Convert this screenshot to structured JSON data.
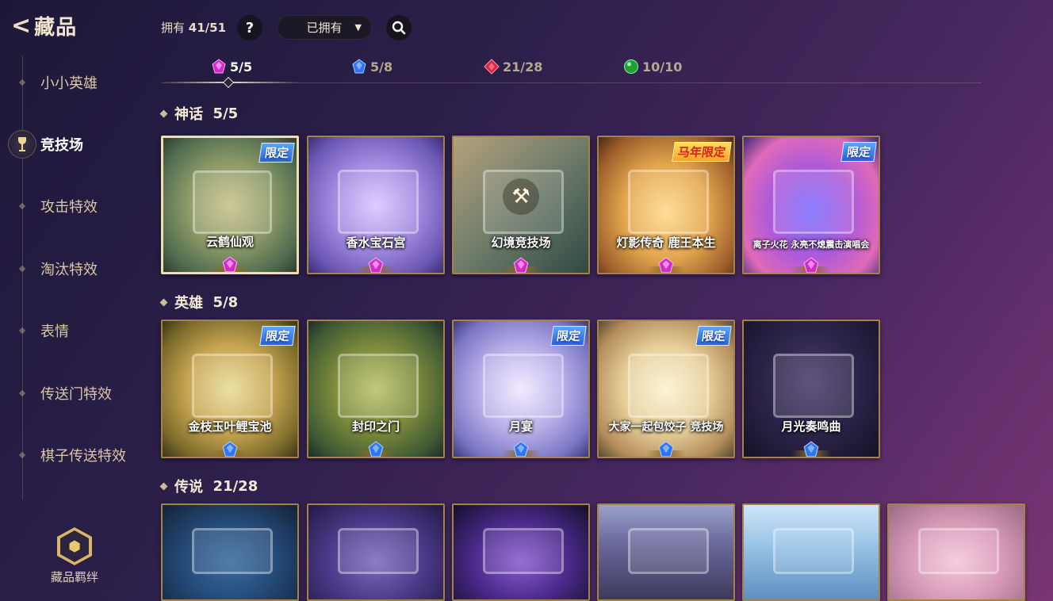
{
  "header": {
    "back_label": "藏品"
  },
  "sidebar": {
    "items": [
      {
        "label": "小小英雄",
        "active": false
      },
      {
        "label": "竞技场",
        "active": true
      },
      {
        "label": "攻击特效",
        "active": false
      },
      {
        "label": "淘汰特效",
        "active": false
      },
      {
        "label": "表情",
        "active": false
      },
      {
        "label": "传送门特效",
        "active": false
      },
      {
        "label": "棋子传送特效",
        "active": false
      }
    ],
    "bond_label": "藏品羁绊"
  },
  "topbar": {
    "owned_label": "拥有",
    "owned_count": "41/51",
    "help_label": "?",
    "filter_value": "已拥有"
  },
  "tabs": [
    {
      "count": "5/5",
      "gem": "pink-gem-icon",
      "color": "#d22cc8",
      "active": true
    },
    {
      "count": "5/8",
      "gem": "blue-gem-icon",
      "color": "#2f74f0",
      "active": false
    },
    {
      "count": "21/28",
      "gem": "red-gem-icon",
      "color": "#d8243a",
      "active": false
    },
    {
      "count": "10/10",
      "gem": "green-orb-icon",
      "color": "#1fa033",
      "active": false
    }
  ],
  "sections": {
    "mythic": {
      "title": "神话",
      "count": "5/5",
      "cards": [
        {
          "name": "云鹤仙观",
          "badge": "限定",
          "selected": true
        },
        {
          "name": "香水宝石宫",
          "badge": ""
        },
        {
          "name": "幻境竞技场",
          "badge": ""
        },
        {
          "name": "灯影传奇  鹿王本生",
          "badge": "马年限定"
        },
        {
          "name": "离子火花  永亮不熄震击演唱会",
          "badge": "限定"
        }
      ]
    },
    "hero": {
      "title": "英雄",
      "count": "5/8",
      "cards": [
        {
          "name": "金枝玉叶鲤宝池",
          "badge": "限定"
        },
        {
          "name": "封印之门",
          "badge": ""
        },
        {
          "name": "月宴",
          "badge": "限定"
        },
        {
          "name": "大家一起包饺子  竞技场",
          "badge": "限定"
        },
        {
          "name": "月光奏鸣曲",
          "badge": ""
        }
      ]
    },
    "legend": {
      "title": "传说",
      "count": "21/28"
    }
  },
  "colors": {
    "accent_gold": "#a58345",
    "mythic_gem": "#d22cc8",
    "hero_gem": "#2f74f0",
    "legend_gem": "#d8243a",
    "badge_blue": "#2b62d6"
  }
}
